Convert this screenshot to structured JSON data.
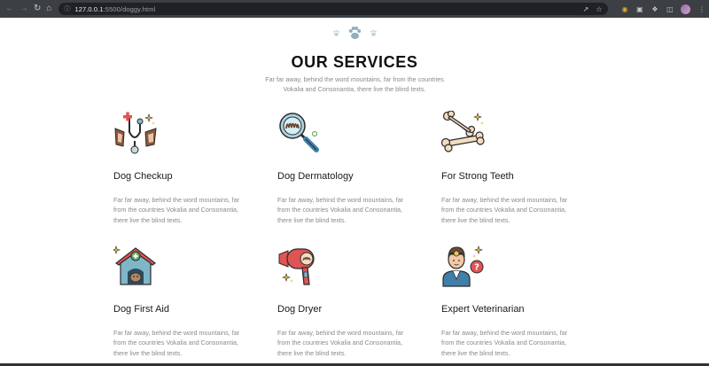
{
  "browser": {
    "url_host": "127.0.0.1",
    "url_path": ":5500/doggy.html"
  },
  "page": {
    "heading": "OUR SERVICES",
    "subtitle_line1": "Far far away, behind the word mountains, far from the countries",
    "subtitle_line2": "Vokalia and Consonantia, there live the blind texts.",
    "services": [
      {
        "title": "Dog Checkup",
        "icon": "stethoscope-dog-icon",
        "desc": [
          "Far far away, behind the word mountains, far",
          "from the countries Vokalia and Consonantia,",
          "there live the blind texts."
        ]
      },
      {
        "title": "Dog Dermatology",
        "icon": "magnifier-fur-icon",
        "desc": [
          "Far far away, behind the word mountains, far",
          "from the countries Vokalia and Consonantia,",
          "there live the blind texts."
        ]
      },
      {
        "title": "For Strong Teeth",
        "icon": "bone-icon",
        "desc": [
          "Far far away, behind the word mountains, far",
          "from the countries Vokalia and Consonantia,",
          "there live the blind texts."
        ]
      },
      {
        "title": "Dog First Aid",
        "icon": "doghouse-first-aid-icon",
        "desc": [
          "Far far away, behind the word mountains, far",
          "from the countries Vokalia and Consonantia,",
          "there live the blind texts."
        ]
      },
      {
        "title": "Dog Dryer",
        "icon": "hair-dryer-icon",
        "desc": [
          "Far far away, behind the word mountains, far",
          "from the countries Vokalia and Consonantia,",
          "there live the blind texts."
        ]
      },
      {
        "title": "Expert Veterinarian",
        "icon": "veterinarian-icon",
        "desc": [
          "Far far away, behind the word mountains, far",
          "from the countries Vokalia and Consonantia,",
          "there live the blind texts."
        ]
      }
    ]
  },
  "colors": {
    "accent_teal": "#9bb9c4",
    "text_dark": "#111111",
    "text_gray": "#8a8a8a"
  }
}
